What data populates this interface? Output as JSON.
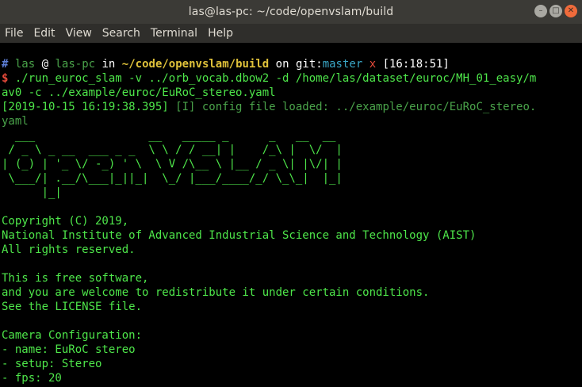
{
  "window": {
    "title": "las@las-pc: ~/code/openvslam/build",
    "controls": {
      "minimize": "–",
      "maximize": "□",
      "close": "✕"
    }
  },
  "menu": [
    "File",
    "Edit",
    "View",
    "Search",
    "Terminal",
    "Help"
  ],
  "prompt": {
    "hash": "#",
    "user": "las",
    "at": "@",
    "host": "las-pc",
    "in": "in",
    "path": "~/code/openvslam/build",
    "on": "on",
    "git": "git:",
    "branch": "master",
    "dirty": "x",
    "time": "[16:18:51]",
    "dollar": "$"
  },
  "command": {
    "line1": "./run_euroc_slam -v ../orb_vocab.dbow2 -d /home/las/dataset/euroc/MH_01_easy/m",
    "line2": "av0 -c ../example/euroc/EuRoC_stereo.yaml"
  },
  "log": {
    "timestamp": "[2019-10-15 16:19:38.395]",
    "message_line1": " [I] config file loaded: ../example/euroc/EuRoC_stereo.",
    "message_line2": "yaml"
  },
  "ascii_art": [
    "  ___                 __   _____ _      _   __  __ ",
    " / _ \\ _ __  ___ _ _  \\ \\ / / __| |    /_\\ |  \\/  |",
    "| (_) | '_ \\/ -_) ' \\  \\ V /\\__ \\ |__ / _ \\| |\\/| |",
    " \\___/| .__/\\___|_||_|  \\_/ |___/____/_/ \\_\\_|  |_|",
    "      |_|                                          "
  ],
  "info_lines": [
    "",
    "Copyright (C) 2019,",
    "National Institute of Advanced Industrial Science and Technology (AIST)",
    "All rights reserved.",
    "",
    "This is free software,",
    "and you are welcome to redistribute it under certain conditions.",
    "See the LICENSE file.",
    "",
    "Camera Configuration:",
    "- name: EuRoC stereo",
    "- setup: Stereo",
    "- fps: 20"
  ]
}
